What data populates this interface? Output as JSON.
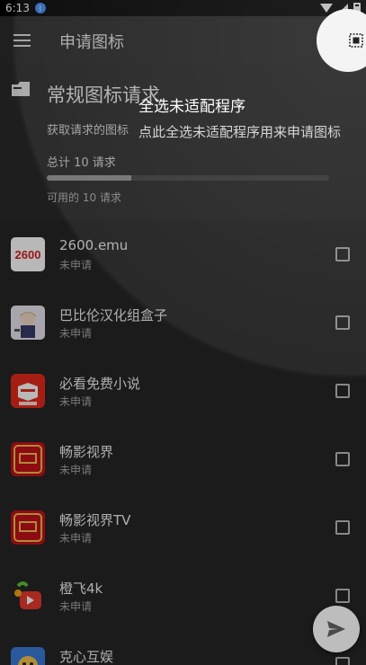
{
  "status_bar": {
    "time": "6:13"
  },
  "app_bar": {
    "title": "申请图标"
  },
  "summary_card": {
    "title": "常规图标请求",
    "subtitle": "获取请求的图标",
    "total": "总计 10 请求",
    "available": "可用的 10 请求",
    "progress_fraction": 0.3
  },
  "tutorial": {
    "title": "全选未适配程序",
    "description": "点此全选未适配程序用来申请图标"
  },
  "apps": [
    {
      "name": "2600.emu",
      "status": "未申请",
      "icon": "emu-2600-icon",
      "checked": false
    },
    {
      "name": "巴比伦汉化组盒子",
      "status": "未申请",
      "icon": "anime-girl-icon",
      "checked": false
    },
    {
      "name": "必看免费小说",
      "status": "未申请",
      "icon": "red-book-icon",
      "checked": false
    },
    {
      "name": "畅影视界",
      "status": "未申请",
      "icon": "red-gold-frame-icon",
      "checked": false
    },
    {
      "name": "畅影视界TV",
      "status": "未申请",
      "icon": "red-gold-frame-icon",
      "checked": false
    },
    {
      "name": "橙飞4k",
      "status": "未申请",
      "icon": "play-tv-icon",
      "checked": false
    },
    {
      "name": "克心互娱",
      "status": "",
      "icon": "cartoon-icon",
      "checked": false
    }
  ],
  "colors": {
    "background": "#262626",
    "app_bar": "#2c2c2c",
    "overlay": "#000000",
    "fab": "#bdbdbd"
  }
}
